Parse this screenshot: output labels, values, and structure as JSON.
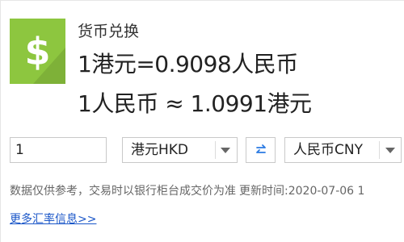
{
  "widget": {
    "title": "货币兑换",
    "logo_icon": "dollar-sign-icon",
    "logo_glyph": "$",
    "accent_color": "#8dc63f",
    "rate_main": "1港元=0.9098人民币",
    "rate_inverse": "1人民币 ≈ 1.0991港元"
  },
  "converter": {
    "amount_value": "1",
    "from_currency": "港元HKD",
    "to_currency": "人民币CNY",
    "swap_icon": "swap-arrows-icon",
    "dropdown_icon": "chevron-down-icon"
  },
  "footer": {
    "disclaimer": "数据仅供参考，交易时以银行柜台成交价为准",
    "update_label": "更新时间:2020-07-06 1",
    "more_link": "更多汇率信息>>",
    "link_color": "#1a56c8"
  }
}
